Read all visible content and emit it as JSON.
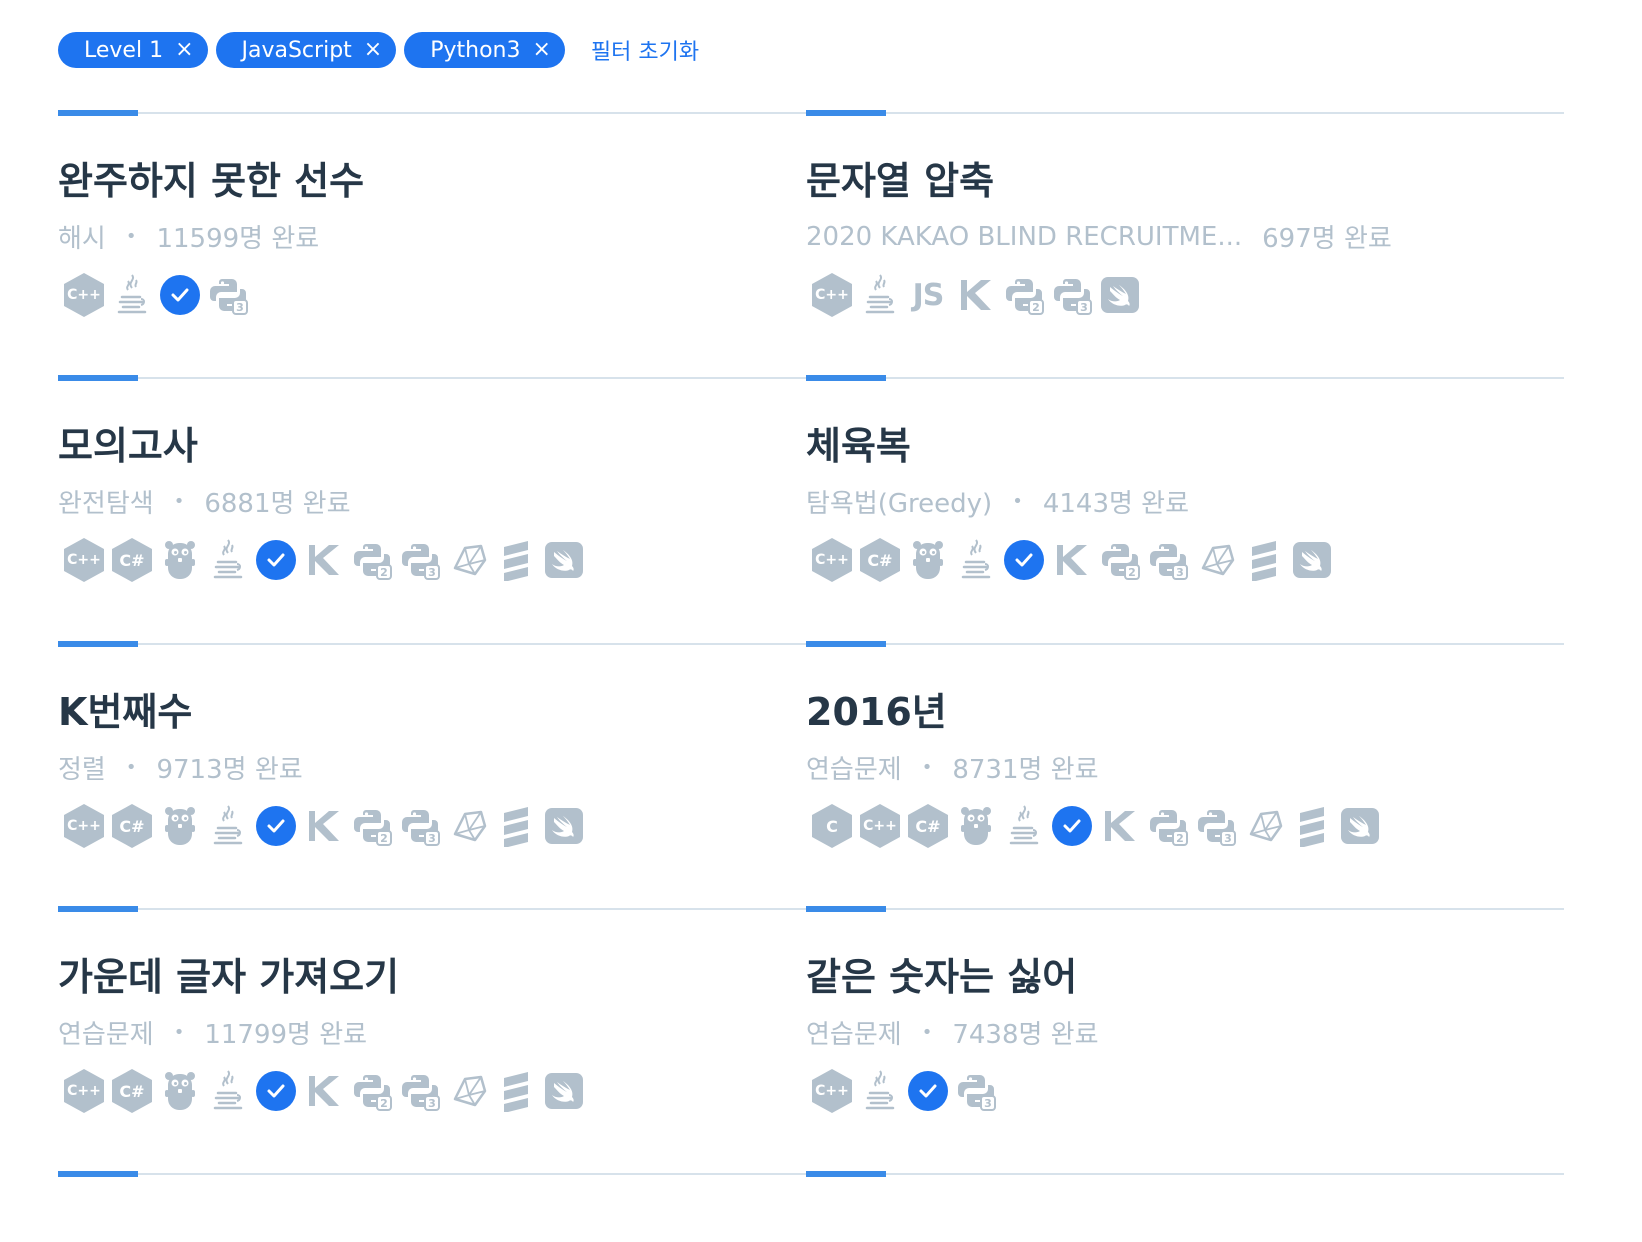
{
  "filters": {
    "chips": [
      {
        "label": "Level 1",
        "close": "×"
      },
      {
        "label": "JavaScript",
        "close": "×"
      },
      {
        "label": "Python3",
        "close": "×"
      }
    ],
    "reset_label": "필터 초기화"
  },
  "colors": {
    "accent": "#1e74f0",
    "icon_gray": "#b2c0cc",
    "title_text": "#263747",
    "divider": "#d7e2eb"
  },
  "problems": [
    {
      "title": "완주하지 못한 선수",
      "category": "해시",
      "separator": "•",
      "completed": "11599명 완료",
      "langs": [
        "cpp",
        "java",
        "javascript",
        "python3"
      ]
    },
    {
      "title": "문자열 압축",
      "category": "2020 KAKAO BLIND RECRUITME...",
      "separator": "",
      "completed": "697명 완료",
      "langs": [
        "cpp",
        "java",
        "js",
        "kotlin",
        "python2",
        "python3",
        "swift"
      ]
    },
    {
      "title": "모의고사",
      "category": "완전탐색",
      "separator": "•",
      "completed": "6881명 완료",
      "langs": [
        "cpp",
        "csharp",
        "go",
        "java",
        "javascript",
        "kotlin",
        "python2",
        "python3",
        "ruby",
        "scala",
        "swift"
      ]
    },
    {
      "title": "체육복",
      "category": "탐욕법(Greedy)",
      "separator": "•",
      "completed": "4143명 완료",
      "langs": [
        "cpp",
        "csharp",
        "go",
        "java",
        "javascript",
        "kotlin",
        "python2",
        "python3",
        "ruby",
        "scala",
        "swift"
      ]
    },
    {
      "title": "K번째수",
      "category": "정렬",
      "separator": "•",
      "completed": "9713명 완료",
      "langs": [
        "cpp",
        "csharp",
        "go",
        "java",
        "javascript",
        "kotlin",
        "python2",
        "python3",
        "ruby",
        "scala",
        "swift"
      ]
    },
    {
      "title": "2016년",
      "category": "연습문제",
      "separator": "•",
      "completed": "8731명 완료",
      "langs": [
        "c",
        "cpp",
        "csharp",
        "go",
        "java",
        "javascript",
        "kotlin",
        "python2",
        "python3",
        "ruby",
        "scala",
        "swift"
      ]
    },
    {
      "title": "가운데 글자 가져오기",
      "category": "연습문제",
      "separator": "•",
      "completed": "11799명 완료",
      "langs": [
        "cpp",
        "csharp",
        "go",
        "java",
        "javascript",
        "kotlin",
        "python2",
        "python3",
        "ruby",
        "scala",
        "swift"
      ]
    },
    {
      "title": "같은 숫자는 싫어",
      "category": "연습문제",
      "separator": "•",
      "completed": "7438명 완료",
      "langs": [
        "cpp",
        "java",
        "javascript",
        "python3"
      ]
    }
  ],
  "icon_text": {
    "c": "C",
    "cpp": "C++",
    "csharp": "C#",
    "js": "JS",
    "python2_sub": "2",
    "python3_sub": "3"
  }
}
